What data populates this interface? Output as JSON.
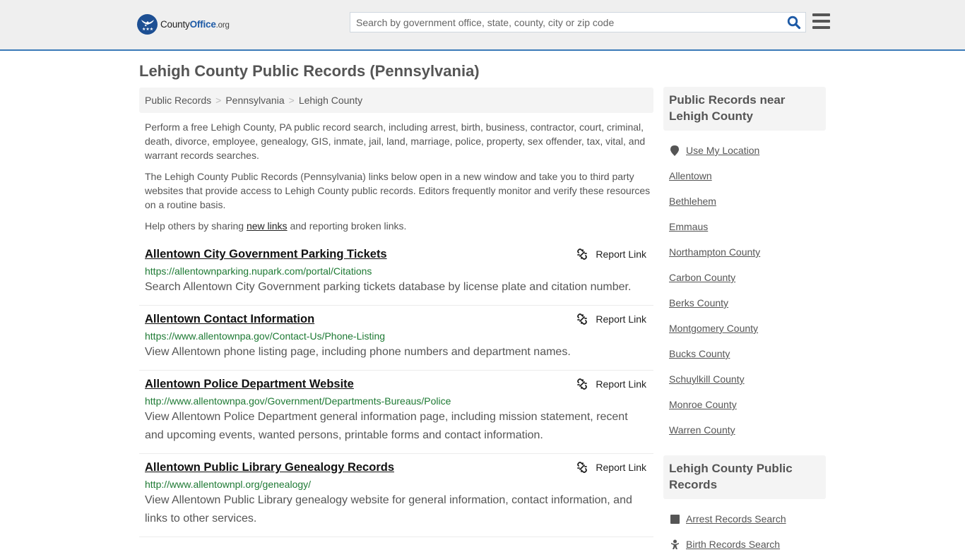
{
  "header": {
    "logo": {
      "name": "County",
      "name_bold": "Office",
      "tld": ".org"
    },
    "search": {
      "placeholder": "Search by government office, state, county, city or zip code",
      "value": ""
    },
    "accent_color": "#3a7ab8",
    "brand_color": "#1d4f93"
  },
  "page": {
    "title": "Lehigh County Public Records (Pennsylvania)",
    "breadcrumb": [
      "Public Records",
      "Pennsylvania",
      "Lehigh County"
    ],
    "intro_1": "Perform a free Lehigh County, PA public record search, including arrest, birth, business, contractor, court, criminal, death, divorce, employee, genealogy, GIS, inmate, jail, land, marriage, police, property, sex offender, tax, vital, and warrant records searches.",
    "intro_2": "The Lehigh County Public Records (Pennsylvania) links below open in a new window and take you to third party websites that provide access to Lehigh County public records. Editors frequently monitor and verify these resources on a routine basis.",
    "help_before": "Help others by sharing ",
    "help_link": "new links",
    "help_after": " and reporting broken links."
  },
  "records": [
    {
      "title": "Allentown City Government Parking Tickets",
      "url": "https://allentownparking.nupark.com/portal/Citations",
      "description": "Search Allentown City Government parking tickets database by license plate and citation number.",
      "report_label": "Report Link"
    },
    {
      "title": "Allentown Contact Information",
      "url": "https://www.allentownpa.gov/Contact-Us/Phone-Listing",
      "description": "View Allentown phone listing page, including phone numbers and department names.",
      "report_label": "Report Link"
    },
    {
      "title": "Allentown Police Department Website",
      "url": "http://www.allentownpa.gov/Government/Departments-Bureaus/Police",
      "description": "View Allentown Police Department general information page, including mission statement, recent and upcoming events, wanted persons, printable forms and contact information.",
      "report_label": "Report Link"
    },
    {
      "title": "Allentown Public Library Genealogy Records",
      "url": "http://www.allentownpl.org/genealogy/",
      "description": "View Allentown Public Library genealogy website for general information, contact information, and links to other services.",
      "report_label": "Report Link"
    }
  ],
  "sidebar": {
    "nearby": {
      "heading": "Public Records near Lehigh County",
      "location_label": "Use My Location",
      "items": [
        "Allentown",
        "Bethlehem",
        "Emmaus",
        "Northampton County",
        "Carbon County",
        "Berks County",
        "Montgomery County",
        "Bucks County",
        "Schuylkill County",
        "Monroe County",
        "Warren County"
      ]
    },
    "county_records": {
      "heading": "Lehigh County Public Records",
      "items": [
        {
          "label": "Arrest Records Search",
          "icon": "arrest-icon"
        },
        {
          "label": "Birth Records Search",
          "icon": "baby-icon"
        }
      ]
    }
  }
}
